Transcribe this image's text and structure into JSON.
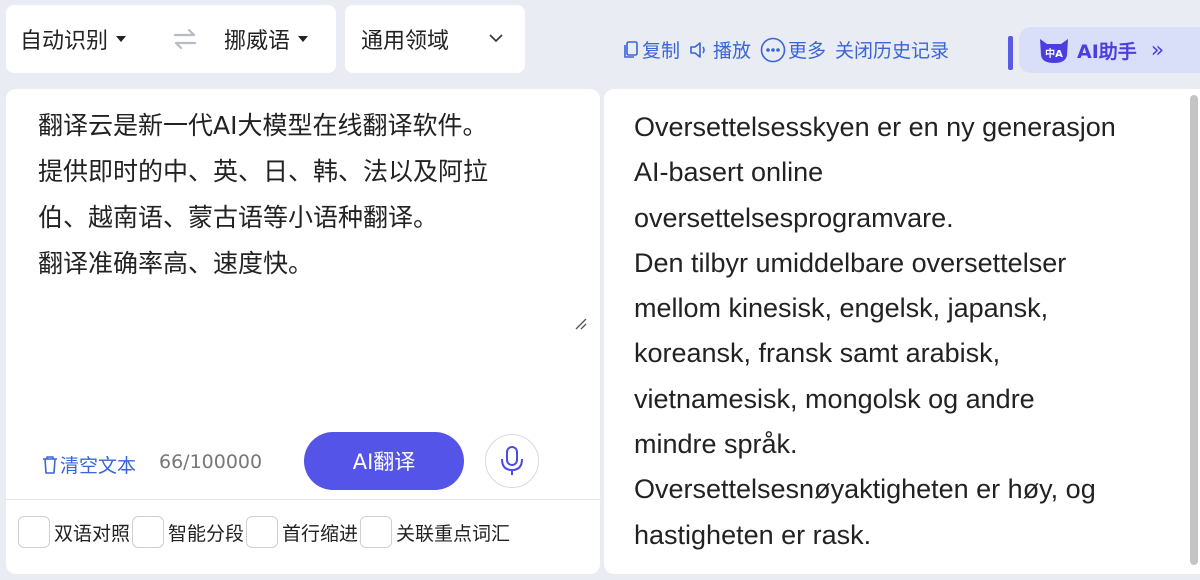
{
  "language_bar": {
    "source_language": "自动识别",
    "target_language": "挪威语",
    "swap_icon": "swap-arrows-icon"
  },
  "domain_selector": {
    "value": "通用领域"
  },
  "toolbar": {
    "copy_label": "复制",
    "play_label": "播放",
    "more_label": "更多",
    "history_label": "关闭历史记录",
    "accent_color": "#3a64d8"
  },
  "ai_helper": {
    "label": "AI助手",
    "icon_text": "中A",
    "color": "#4b3ee0"
  },
  "source": {
    "lines": [
      "翻译云是新一代AI大模型在线翻译软件。",
      "提供即时的中、英、日、韩、法以及阿拉",
      "伯、越南语、蒙古语等小语种翻译。",
      "翻译准确率高、速度快。"
    ],
    "clear_label": "清空文本",
    "char_count": "66/100000",
    "translate_label": "AI翻译",
    "translate_color": "#5554e8"
  },
  "options": [
    {
      "label": "双语对照"
    },
    {
      "label": "智能分段"
    },
    {
      "label": "首行缩进"
    },
    {
      "label": "关联重点词汇"
    }
  ],
  "target": {
    "lines": [
      "Oversettelsesskyen er en ny generasjon",
      "AI-basert online",
      "oversettelsesprogramvare.",
      "Den tilbyr umiddelbare oversettelser",
      "mellom kinesisk, engelsk, japansk,",
      "koreansk, fransk samt arabisk,",
      "vietnamesisk, mongolsk og andre",
      "mindre språk.",
      "Oversettelsesnøyaktigheten er høy, og",
      "hastigheten er rask."
    ]
  }
}
